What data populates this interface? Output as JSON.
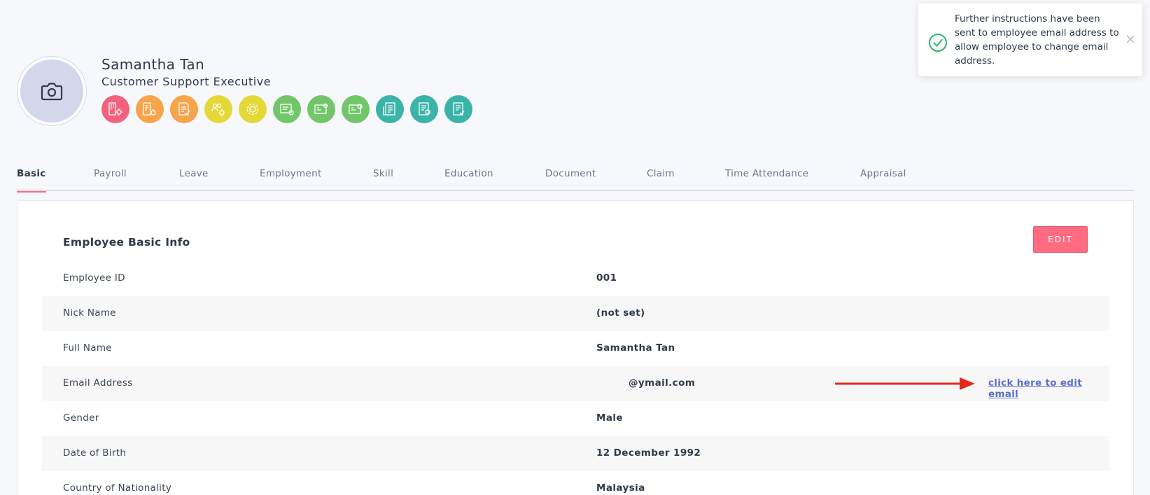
{
  "profile": {
    "name": "Samantha Tan",
    "title": "Customer Support Executive",
    "module_icons": [
      {
        "name": "building-gear-icon",
        "color": "#f4617f"
      },
      {
        "name": "building-doc-icon",
        "color": "#f7a44a"
      },
      {
        "name": "document-check-icon",
        "color": "#f7a44a"
      },
      {
        "name": "people-gear-icon",
        "color": "#e5d93a"
      },
      {
        "name": "gear-icon",
        "color": "#e5d93a"
      },
      {
        "name": "card-gear-icon",
        "color": "#72c66a"
      },
      {
        "name": "id-card-icon",
        "color": "#72c66a"
      },
      {
        "name": "id-card-badge-icon",
        "color": "#72c66a"
      },
      {
        "name": "list-doc-icon",
        "color": "#3ab3a8"
      },
      {
        "name": "user-doc-icon",
        "color": "#3ab3a8"
      },
      {
        "name": "user-list-icon",
        "color": "#3ab3a8"
      }
    ]
  },
  "toast": {
    "message": "Further instructions have been sent to employee email address to allow employee to change email address.",
    "accent_color": "#2bb673"
  },
  "tabs": [
    {
      "label": "Basic",
      "active": true
    },
    {
      "label": "Payroll"
    },
    {
      "label": "Leave"
    },
    {
      "label": "Employment"
    },
    {
      "label": "Skill"
    },
    {
      "label": "Education"
    },
    {
      "label": "Document"
    },
    {
      "label": "Claim"
    },
    {
      "label": "Time Attendance"
    },
    {
      "label": "Appraisal"
    }
  ],
  "basic_info": {
    "heading": "Employee Basic Info",
    "edit_label": "EDIT",
    "edit_email_link": "click here to edit email",
    "rows": [
      {
        "label": "Employee ID",
        "value": "001"
      },
      {
        "label": "Nick Name",
        "value": "(not set)"
      },
      {
        "label": "Full Name",
        "value": "Samantha Tan"
      },
      {
        "label": "Email Address",
        "value": "@ymail.com"
      },
      {
        "label": "Gender",
        "value": "Male"
      },
      {
        "label": "Date of Birth",
        "value": "12 December 1992"
      },
      {
        "label": "Country of Nationality",
        "value": "Malaysia"
      }
    ]
  },
  "colors": {
    "accent": "#ff6b81",
    "link": "#5b6fc8",
    "annotation_arrow": "#e8271b"
  }
}
